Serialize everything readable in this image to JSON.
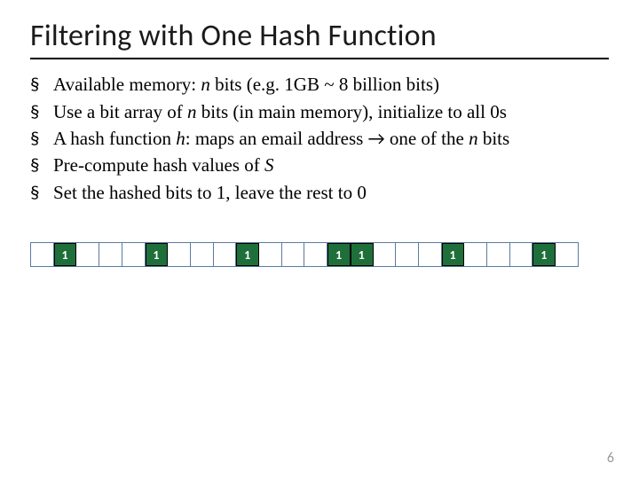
{
  "title": "Filtering with One Hash Function",
  "bullets": [
    {
      "pre": "Available memory: ",
      "ital1": "n",
      "mid1": " bits (e.g. 1GB ~ 8 billion bits)"
    },
    {
      "pre": "Use a bit array of ",
      "ital1": "n",
      "mid1": " bits (in main memory), initialize to all 0s"
    },
    {
      "pre": "A hash function ",
      "ital1": "h",
      "mid1": ": maps an email address ",
      "arrow": "→",
      "mid2": " one of the ",
      "ital2": "n",
      "mid3": " bits"
    },
    {
      "pre": "Pre-compute hash values of ",
      "ital1": "S",
      "mid1": ""
    },
    {
      "pre": "Set the hashed bits to 1, leave the rest to 0"
    }
  ],
  "bitarray": {
    "length": 24,
    "set_indices": [
      1,
      5,
      9,
      13,
      14,
      18,
      22
    ],
    "set_label": "1"
  },
  "page_number": "6"
}
